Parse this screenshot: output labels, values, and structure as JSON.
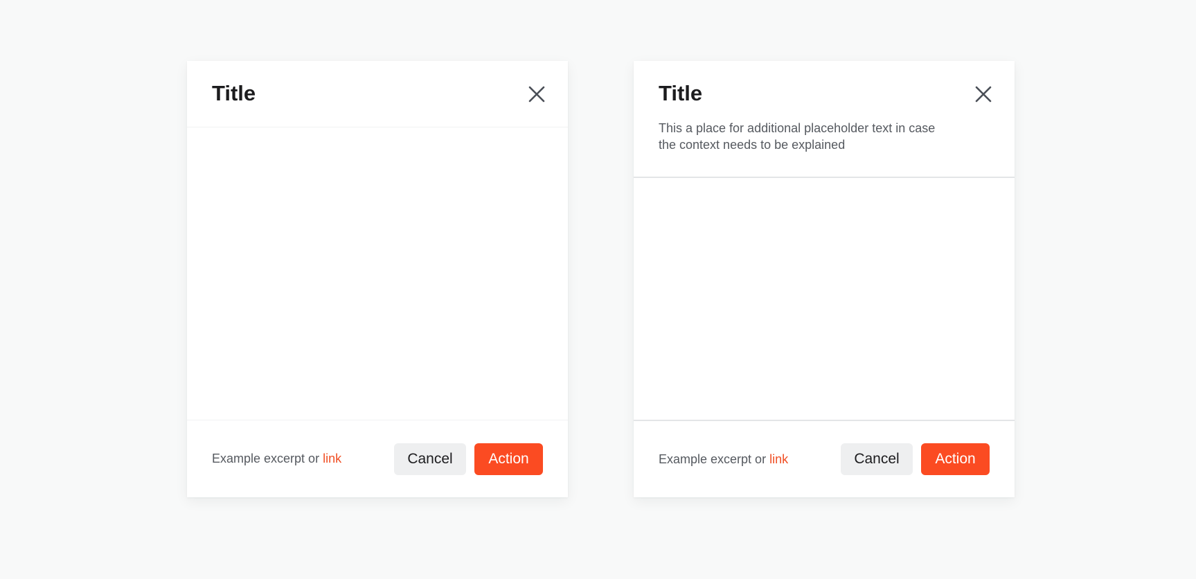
{
  "modals": [
    {
      "title": "Title",
      "subtitle": "",
      "footer_text": "Example excerpt or ",
      "footer_link": "link",
      "cancel_label": "Cancel",
      "action_label": "Action",
      "close_icon": "close-icon"
    },
    {
      "title": "Title",
      "subtitle": "This a place for additional placeholder text in case the context needs to be explained",
      "footer_text": "Example excerpt or ",
      "footer_link": "link",
      "cancel_label": "Cancel",
      "action_label": "Action",
      "close_icon": "close-icon"
    }
  ],
  "colors": {
    "accent": "#fb4b22",
    "link": "#f04e23",
    "background": "#f8f9f9",
    "surface": "#ffffff",
    "title_text": "#1c1c1e",
    "body_text": "#55595f",
    "secondary_button": "#eeeff0",
    "icon": "#4a4f57"
  }
}
